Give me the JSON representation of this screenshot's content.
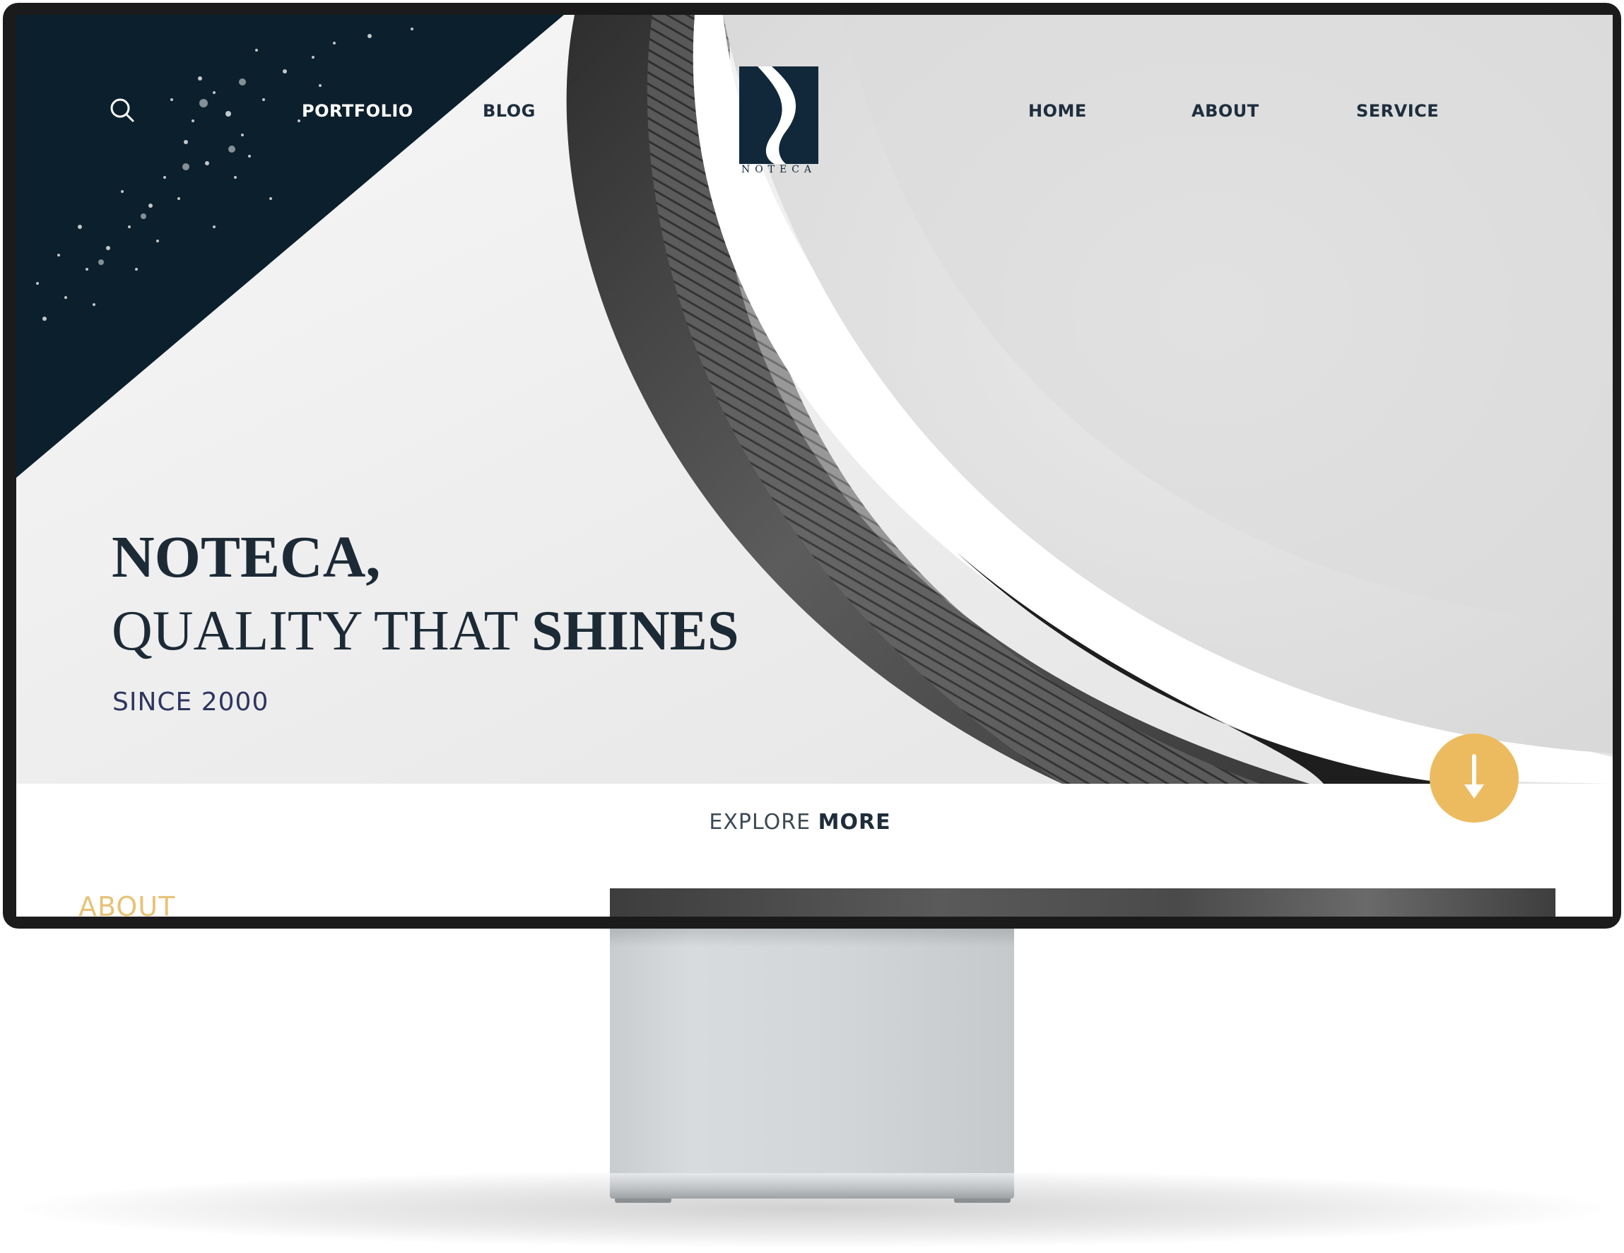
{
  "nav": {
    "left": [
      "PORTFOLIO",
      "BLOG"
    ],
    "right": [
      "HOME",
      "ABOUT",
      "SERVICE"
    ]
  },
  "logo": {
    "text": "NOTECA"
  },
  "hero": {
    "line1": "NOTECA,",
    "line2_regular": "QUALITY THAT ",
    "line2_bold": "SHINES",
    "since": "SINCE 2000"
  },
  "explore": {
    "regular": "EXPLORE ",
    "bold": "MORE"
  },
  "about": {
    "label": "ABOUT"
  },
  "icons": {
    "search": "search-icon",
    "scroll": "arrow-down-icon",
    "logo": "noteca-logo-icon"
  },
  "colors": {
    "navy": "#0b1f2c",
    "accent": "#ecbb5f",
    "text": "#1c2a36",
    "since": "#2e3560",
    "about": "#e7c277"
  }
}
